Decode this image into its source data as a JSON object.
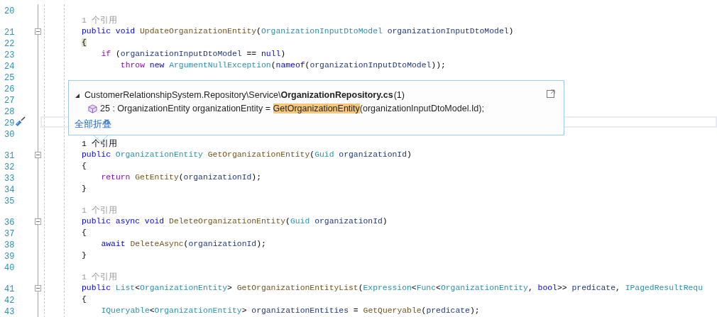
{
  "editor": {
    "rows": [
      {
        "kind": "code",
        "number": "20",
        "tokens": []
      },
      {
        "kind": "lens",
        "text": "1 个引用",
        "hovered": false
      },
      {
        "kind": "code",
        "number": "21",
        "fold": {
          "expanded": true
        },
        "tokens": [
          {
            "kind": "kw",
            "text": "public"
          },
          {
            "kind": "kw",
            "text": " void"
          },
          {
            "kind": "method",
            "text": " UpdateOrganizationEntity"
          },
          {
            "kind": "plain",
            "text": "("
          },
          {
            "kind": "type",
            "text": "OrganizationInputDtoModel"
          },
          {
            "kind": "param",
            "text": " organizationInputDtoModel"
          },
          {
            "kind": "plain",
            "text": ")"
          }
        ]
      },
      {
        "kind": "code",
        "number": "22",
        "tokens": [
          {
            "kind": "match",
            "text": "{"
          }
        ]
      },
      {
        "kind": "code",
        "number": "23",
        "tokens": [
          {
            "kind": "ctl",
            "text": "    if"
          },
          {
            "kind": "plain",
            "text": " ("
          },
          {
            "kind": "param",
            "text": "organizationInputDtoModel"
          },
          {
            "kind": "plain",
            "text": " == "
          },
          {
            "kind": "kw",
            "text": "null"
          },
          {
            "kind": "plain",
            "text": ")"
          }
        ]
      },
      {
        "kind": "code",
        "number": "24",
        "tokens": [
          {
            "kind": "ctl",
            "text": "        throw"
          },
          {
            "kind": "kw",
            "text": " new"
          },
          {
            "kind": "type",
            "text": " ArgumentNullException"
          },
          {
            "kind": "plain",
            "text": "("
          },
          {
            "kind": "kw",
            "text": "nameof"
          },
          {
            "kind": "plain",
            "text": "("
          },
          {
            "kind": "param",
            "text": "organizationInputDtoModel"
          },
          {
            "kind": "plain",
            "text": "));"
          }
        ]
      },
      {
        "kind": "code",
        "number": "25",
        "tokens": []
      },
      {
        "kind": "code",
        "number": "26",
        "tokens": []
      },
      {
        "kind": "code",
        "number": "27",
        "tokens": []
      },
      {
        "kind": "code",
        "number": "28",
        "tokens": []
      },
      {
        "kind": "code",
        "number": "29",
        "current": true,
        "quick_actions": true,
        "tokens": []
      },
      {
        "kind": "code",
        "number": "30",
        "tokens": []
      },
      {
        "kind": "lens",
        "text": "1 个引用",
        "hovered": true
      },
      {
        "kind": "code",
        "number": "31",
        "fold": {
          "expanded": true
        },
        "tokens": [
          {
            "kind": "kw",
            "text": "public"
          },
          {
            "kind": "type",
            "text": " OrganizationEntity"
          },
          {
            "kind": "method",
            "text": " GetOrganizationEntity"
          },
          {
            "kind": "plain",
            "text": "("
          },
          {
            "kind": "type",
            "text": "Guid"
          },
          {
            "kind": "param",
            "text": " organizationId"
          },
          {
            "kind": "plain",
            "text": ")"
          }
        ]
      },
      {
        "kind": "code",
        "number": "32",
        "tokens": [
          {
            "kind": "plain",
            "text": "{"
          }
        ]
      },
      {
        "kind": "code",
        "number": "33",
        "tokens": [
          {
            "kind": "ctl",
            "text": "    return"
          },
          {
            "kind": "method",
            "text": " GetEntity"
          },
          {
            "kind": "plain",
            "text": "("
          },
          {
            "kind": "param",
            "text": "organizationId"
          },
          {
            "kind": "plain",
            "text": ");"
          }
        ]
      },
      {
        "kind": "code",
        "number": "34",
        "tokens": [
          {
            "kind": "plain",
            "text": "}"
          }
        ]
      },
      {
        "kind": "code",
        "number": "35",
        "tokens": []
      },
      {
        "kind": "lens",
        "text": "1 个引用",
        "hovered": false
      },
      {
        "kind": "code",
        "number": "36",
        "fold": {
          "expanded": true
        },
        "tokens": [
          {
            "kind": "kw",
            "text": "public"
          },
          {
            "kind": "kw",
            "text": " async"
          },
          {
            "kind": "kw",
            "text": " void"
          },
          {
            "kind": "method",
            "text": " DeleteOrganizationEntity"
          },
          {
            "kind": "plain",
            "text": "("
          },
          {
            "kind": "type",
            "text": "Guid"
          },
          {
            "kind": "param",
            "text": " organizationId"
          },
          {
            "kind": "plain",
            "text": ")"
          }
        ]
      },
      {
        "kind": "code",
        "number": "37",
        "tokens": [
          {
            "kind": "plain",
            "text": "{"
          }
        ]
      },
      {
        "kind": "code",
        "number": "38",
        "tokens": [
          {
            "kind": "kw",
            "text": "    await"
          },
          {
            "kind": "method",
            "text": " DeleteAsync"
          },
          {
            "kind": "plain",
            "text": "("
          },
          {
            "kind": "param",
            "text": "organizationId"
          },
          {
            "kind": "plain",
            "text": ");"
          }
        ]
      },
      {
        "kind": "code",
        "number": "39",
        "tokens": [
          {
            "kind": "plain",
            "text": "}"
          }
        ]
      },
      {
        "kind": "code",
        "number": "40",
        "tokens": []
      },
      {
        "kind": "lens",
        "text": "1 个引用",
        "hovered": false
      },
      {
        "kind": "code",
        "number": "41",
        "fold": {
          "expanded": true
        },
        "tokens": [
          {
            "kind": "kw",
            "text": "public"
          },
          {
            "kind": "type",
            "text": " List"
          },
          {
            "kind": "plain",
            "text": "<"
          },
          {
            "kind": "type",
            "text": "OrganizationEntity"
          },
          {
            "kind": "plain",
            "text": "> "
          },
          {
            "kind": "method",
            "text": "GetOrganizationEntityList"
          },
          {
            "kind": "plain",
            "text": "("
          },
          {
            "kind": "type",
            "text": "Expression"
          },
          {
            "kind": "plain",
            "text": "<"
          },
          {
            "kind": "type",
            "text": "Func"
          },
          {
            "kind": "plain",
            "text": "<"
          },
          {
            "kind": "type",
            "text": "OrganizationEntity"
          },
          {
            "kind": "plain",
            "text": ", "
          },
          {
            "kind": "kw",
            "text": "bool"
          },
          {
            "kind": "plain",
            "text": ">> "
          },
          {
            "kind": "param",
            "text": "predicate"
          },
          {
            "kind": "plain",
            "text": ", "
          },
          {
            "kind": "type",
            "text": "IPagedResultRequ"
          }
        ]
      },
      {
        "kind": "code",
        "number": "42",
        "tokens": [
          {
            "kind": "plain",
            "text": "{"
          }
        ]
      },
      {
        "kind": "code",
        "number": "43",
        "tokens": [
          {
            "kind": "type",
            "text": "    IQueryable"
          },
          {
            "kind": "plain",
            "text": "<"
          },
          {
            "kind": "type",
            "text": "OrganizationEntity"
          },
          {
            "kind": "plain",
            "text": "> "
          },
          {
            "kind": "param",
            "text": "organizationEntities"
          },
          {
            "kind": "plain",
            "text": " = "
          },
          {
            "kind": "method",
            "text": "GetQueryable"
          },
          {
            "kind": "plain",
            "text": "("
          },
          {
            "kind": "param",
            "text": "predicate"
          },
          {
            "kind": "plain",
            "text": ");"
          }
        ]
      }
    ]
  },
  "peek_popup": {
    "expanded": true,
    "file_prefix": "CustomerRelationshipSystem.Repository\\Service\\",
    "file_name": "OrganizationRepository.cs",
    "count": "(1)",
    "result": {
      "line": "25 : ",
      "before": "OrganizationEntity organizationEntity = ",
      "match": "GetOrganizationEntity",
      "after": "(organizationInputDtoModel.Id);"
    },
    "collapse_link": "全部折叠"
  }
}
